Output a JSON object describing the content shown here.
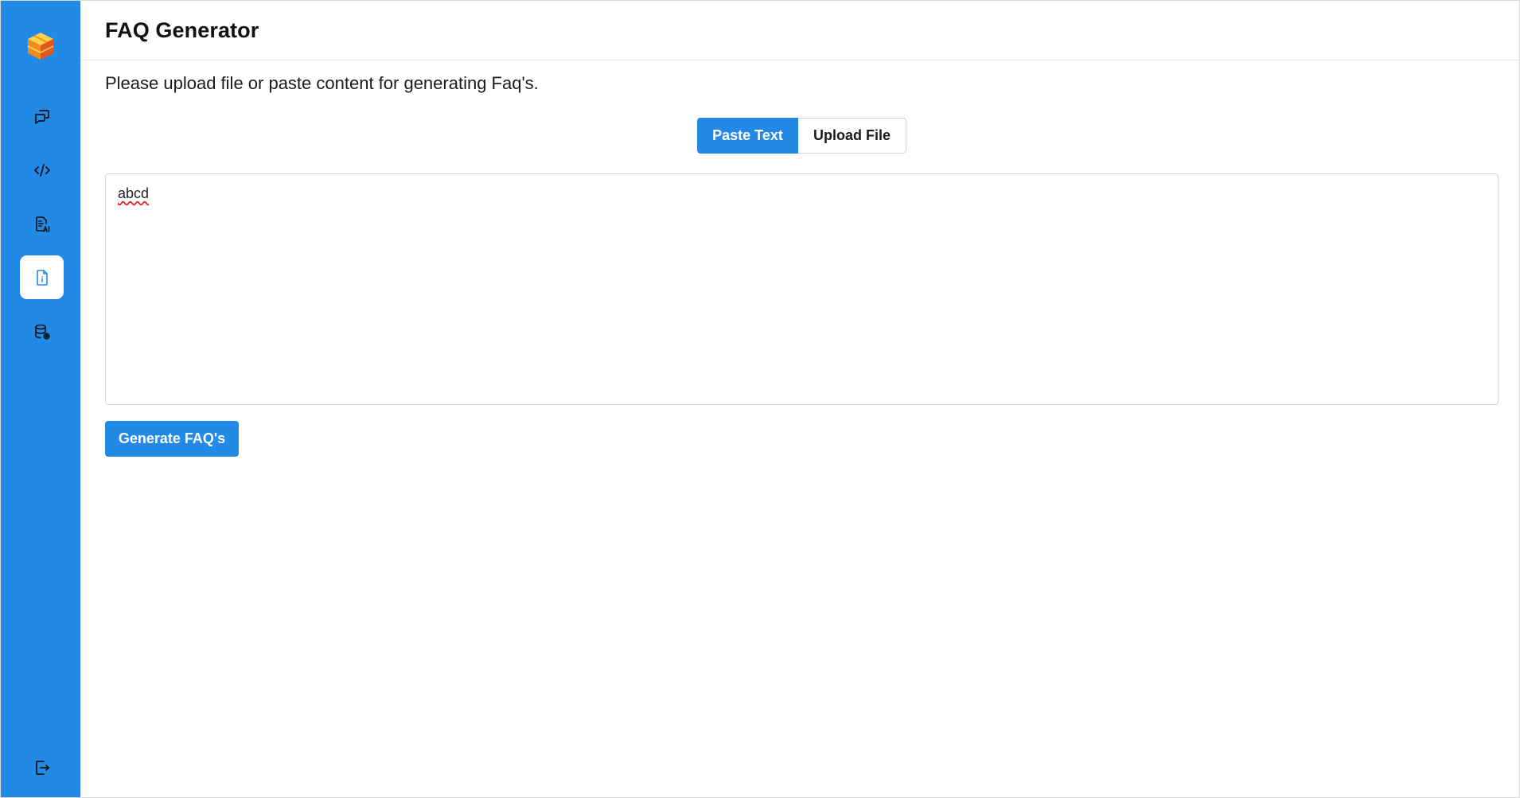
{
  "header": {
    "title": "FAQ Generator"
  },
  "main": {
    "instructions": "Please upload file or paste content for generating Faq's.",
    "mode_toggle": {
      "paste_label": "Paste Text",
      "upload_label": "Upload File",
      "selected": "Paste Text"
    },
    "content_input": {
      "value": "abcd"
    },
    "generate_label": "Generate FAQ's"
  },
  "sidebar": {
    "logo_icon": "cube-stack-logo",
    "items": [
      {
        "icon": "chat-bubbles-icon",
        "active": false
      },
      {
        "icon": "code-icon",
        "active": false
      },
      {
        "icon": "ai-document-icon",
        "active": false
      },
      {
        "icon": "document-info-icon",
        "active": true
      },
      {
        "icon": "database-settings-icon",
        "active": false
      }
    ],
    "logout_icon": "logout-icon"
  },
  "colors": {
    "accent": "#2289e6",
    "sidebar_bg": "#2289e6",
    "border": "#d5d9de"
  }
}
